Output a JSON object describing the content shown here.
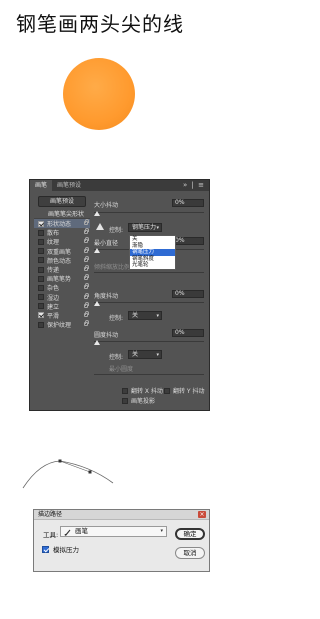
{
  "title": "钢笔画两头尖的线",
  "colors": {
    "orange": "#ff9a2e",
    "panel_bg": "#535353",
    "selection": "#2f6bd3"
  },
  "brush_panel": {
    "tabs": [
      "画笔",
      "画笔预设"
    ],
    "tab_tools": "» | ≡",
    "preset_button": "画笔预设",
    "shape_label": "画笔笔尖形状",
    "options": [
      {
        "label": "形状动态",
        "checked": true,
        "selected": true
      },
      {
        "label": "散布",
        "checked": false
      },
      {
        "label": "纹理",
        "checked": false
      },
      {
        "label": "双重画笔",
        "checked": false
      },
      {
        "label": "颜色动态",
        "checked": false
      },
      {
        "label": "传递",
        "checked": false
      },
      {
        "label": "画笔笔势",
        "checked": false
      },
      {
        "label": "杂色",
        "checked": false
      },
      {
        "label": "湿边",
        "checked": false
      },
      {
        "label": "建立",
        "checked": false
      },
      {
        "label": "平滑",
        "checked": true
      },
      {
        "label": "保护纹理",
        "checked": false
      }
    ],
    "size_jitter_label": "大小抖动",
    "size_jitter_value": "0%",
    "control_label": "控制:",
    "control_value": "钢笔压力",
    "min_diameter_label": "最小直径",
    "min_diameter_value": "0%",
    "tilt_scale_label": "倾斜缩放比例",
    "dropdown_options": [
      "关",
      "渐隐",
      "钢笔压力",
      "钢笔斜度",
      "光笔轮"
    ],
    "dropdown_highlight": "钢笔压力",
    "angle_jitter_label": "角度抖动",
    "angle_jitter_value": "0%",
    "angle_control_label": "控制:",
    "angle_control_value": "关",
    "roundness_jitter_label": "圆度抖动",
    "roundness_jitter_value": "0%",
    "roundness_control_label": "控制:",
    "roundness_control_value": "关",
    "min_roundness_label": "最小圆度",
    "flip_x_label": "翻转 X 抖动",
    "flip_y_label": "翻转 Y 抖动",
    "brush_projection_label": "画笔投影"
  },
  "stroke_dialog": {
    "title": "描边路径",
    "tool_label": "工具:",
    "tool_value": "画笔",
    "simulate_pressure_label": "模拟压力",
    "simulate_pressure_checked": true,
    "ok_label": "确定",
    "cancel_label": "取消"
  }
}
